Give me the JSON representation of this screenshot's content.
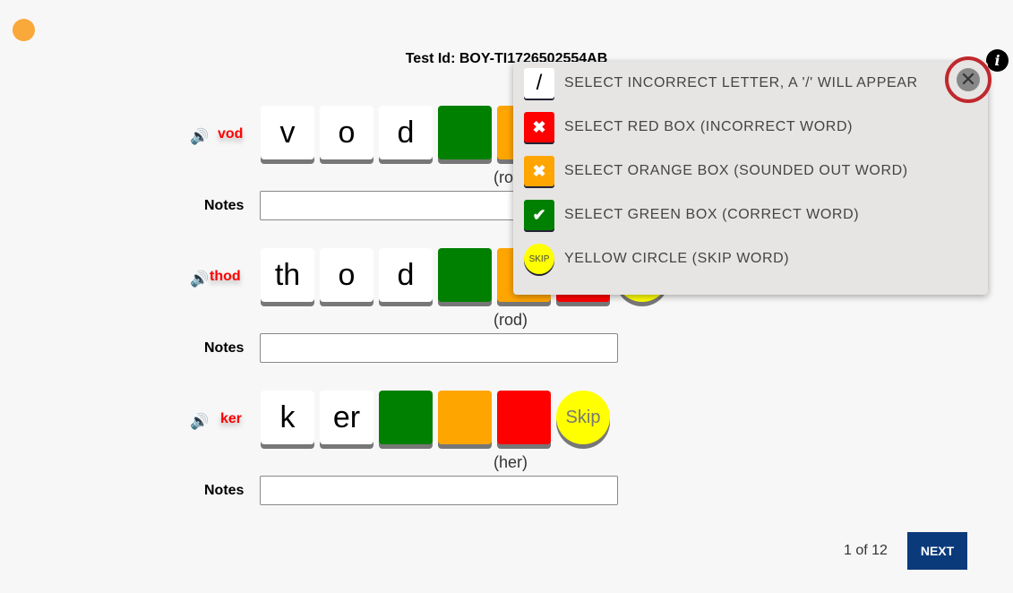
{
  "test_id": "Test Id: BOY-TI1726502554AB",
  "notes_label": "Notes",
  "skip_label": "Skip",
  "rows": [
    {
      "word": "vod",
      "tiles": [
        "v",
        "o",
        "d"
      ],
      "answer": "(rod)",
      "notes": ""
    },
    {
      "word": "thod",
      "tiles": [
        "th",
        "o",
        "d"
      ],
      "answer": "(rod)",
      "notes": ""
    },
    {
      "word": "ker",
      "tiles": [
        "k",
        "er"
      ],
      "answer": "(her)",
      "notes": ""
    }
  ],
  "pager": {
    "text": "1 of 12",
    "next": "NEXT"
  },
  "legend": {
    "items": [
      {
        "icon": "/",
        "text": "SELECT INCORRECT LETTER, A '/' WILL APPEAR"
      },
      {
        "icon": "✖",
        "text": "SELECT RED BOX (INCORRECT WORD)"
      },
      {
        "icon": "✖",
        "text": "SELECT ORANGE BOX (SOUNDED OUT WORD)"
      },
      {
        "icon": "✔",
        "text": "SELECT GREEN BOX (CORRECT WORD)"
      },
      {
        "icon": "SKIP",
        "text": "YELLOW CIRCLE (SKIP WORD)"
      }
    ],
    "close_icon": "✕"
  },
  "colors": {
    "green": "#008000",
    "orange": "#ffa500",
    "red": "#ff0000",
    "yellow": "#ffff00",
    "next": "#0b3a7a"
  }
}
